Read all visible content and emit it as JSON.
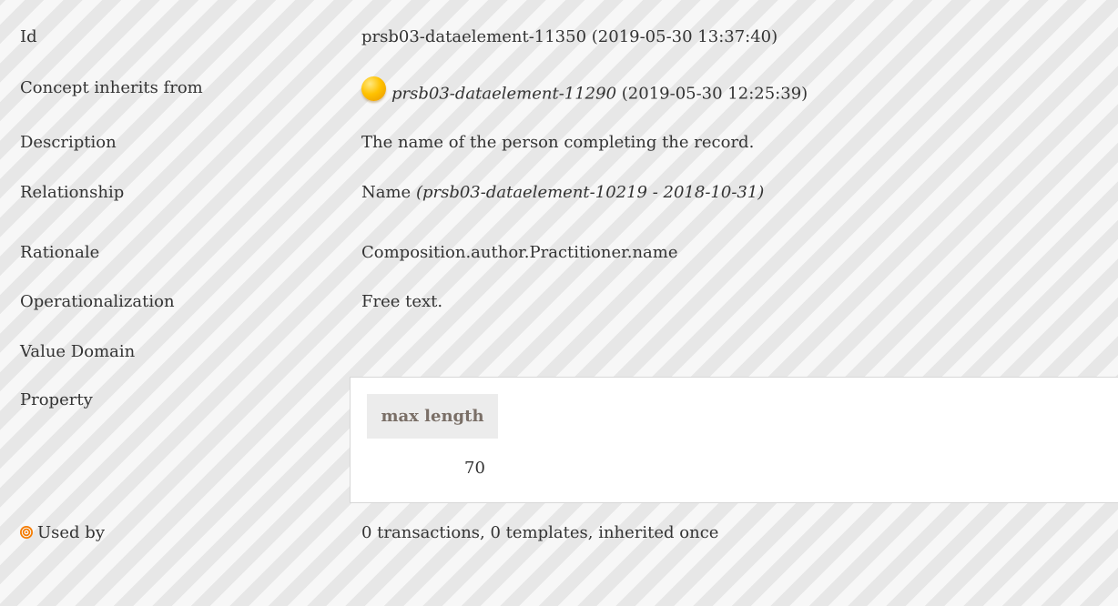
{
  "rows": {
    "id": {
      "label": "Id",
      "value": "prsb03-dataelement-11350 (2019-05-30 13:37:40)"
    },
    "inherits": {
      "label": "Concept inherits from",
      "link": "prsb03-dataelement-11290",
      "date": "(2019-05-30 12:25:39)",
      "icon": "concept-orb-icon"
    },
    "description": {
      "label": "Description",
      "value": "The name of the person completing the record."
    },
    "relationship": {
      "label": "Relationship",
      "name": "Name",
      "ref": "(prsb03-dataelement-10219 - 2018-10-31)"
    },
    "rationale": {
      "label": "Rationale",
      "value": "Composition.author.Practitioner.name"
    },
    "operationalization": {
      "label": "Operationalization",
      "value": "Free text."
    },
    "value_domain": {
      "label": "Value Domain"
    },
    "property": {
      "label": "Property",
      "header": "max length",
      "value": "70"
    },
    "used_by": {
      "label": "Used by",
      "value": "0 transactions, 0 templates, inherited once",
      "icon": "target-icon"
    }
  },
  "colors": {
    "text": "#333333",
    "stripe_light": "#f7f7f7",
    "stripe_dark": "#e7e7e7",
    "property_header_bg": "#ececec",
    "property_header_text": "#7a6f67",
    "orb": "#ffc200",
    "target": "#f57c00"
  }
}
